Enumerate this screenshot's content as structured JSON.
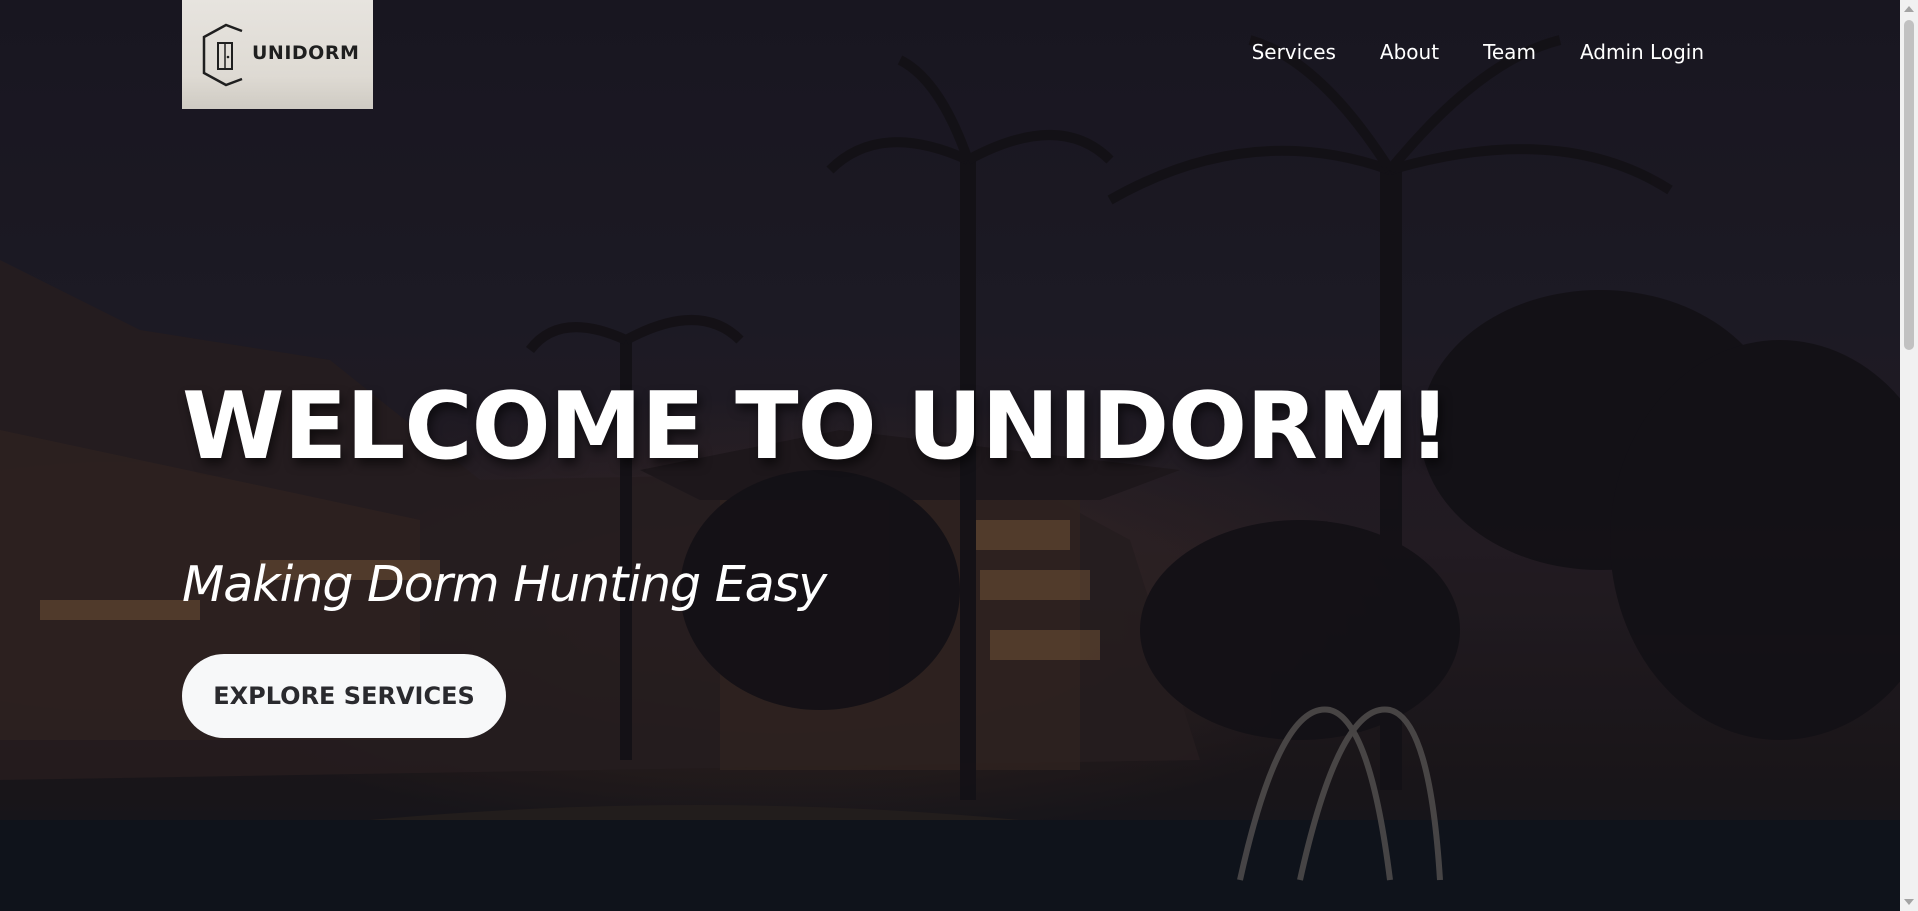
{
  "brand": {
    "logo_text": "UNIDORM",
    "logo_icon": "door-hexagon-icon"
  },
  "nav": {
    "items": [
      {
        "label": "Services"
      },
      {
        "label": "About"
      },
      {
        "label": "Team"
      },
      {
        "label": "Admin Login"
      }
    ]
  },
  "hero": {
    "headline": "WELCOME TO UNIDORM!",
    "tagline": "Making Dorm Hunting Easy",
    "cta_label": "EXPLORE SERVICES"
  },
  "colors": {
    "cta_background": "#f7f8f9",
    "cta_text": "#2a2a2e",
    "text": "#ffffff"
  }
}
